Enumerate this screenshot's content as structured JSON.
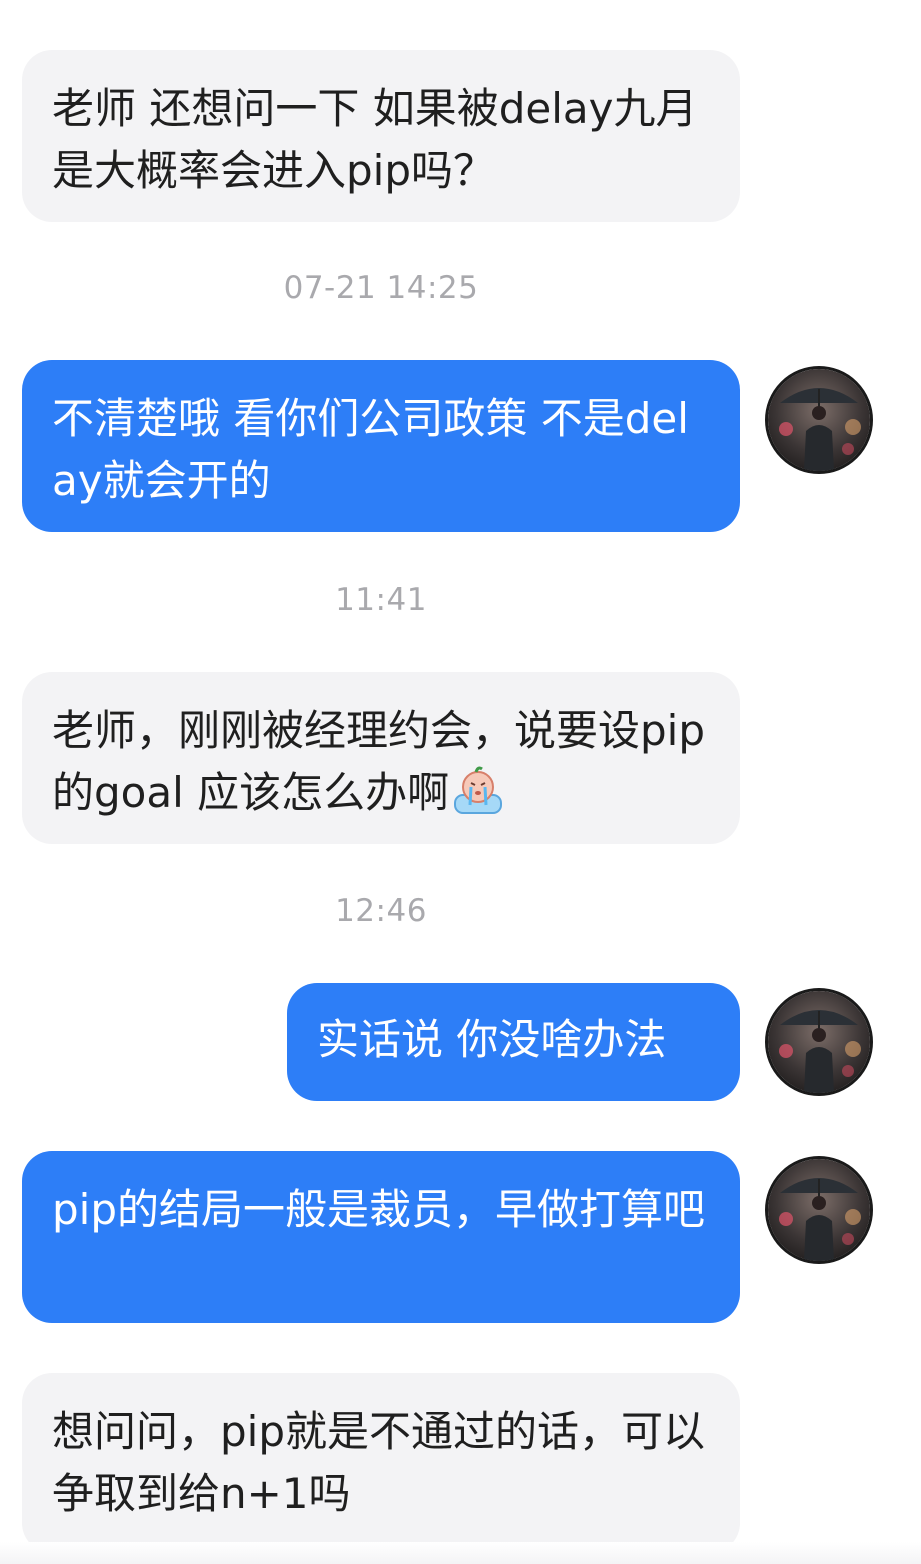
{
  "conversation": {
    "messages": [
      {
        "text": "老师 还想问一下 如果被delay九月是大概率会进入pip吗？"
      },
      {
        "timestamp": "07-21 14:25"
      },
      {
        "text": "不清楚哦 看你们公司政策 不是delay就会开的"
      },
      {
        "timestamp": "11:41"
      },
      {
        "text": "老师，刚刚被经理约会，说要设pip的goal 应该怎么办啊",
        "emoji": "crying-emoji"
      },
      {
        "timestamp": "12:46"
      },
      {
        "text": "实话说 你没啥办法"
      },
      {
        "text": "pip的结局一般是裁员，早做打算吧"
      },
      {
        "text": "想问问，pip就是不通过的话，可以争取到给n+1吗"
      }
    ]
  },
  "colors": {
    "outgoing_bubble": "#2d7ef7",
    "incoming_bubble": "#f3f3f5",
    "timestamp_text": "#a9a9ad"
  },
  "icons": {
    "avatar": "avatar-man-with-umbrella",
    "emoji": "crying-emoji"
  }
}
